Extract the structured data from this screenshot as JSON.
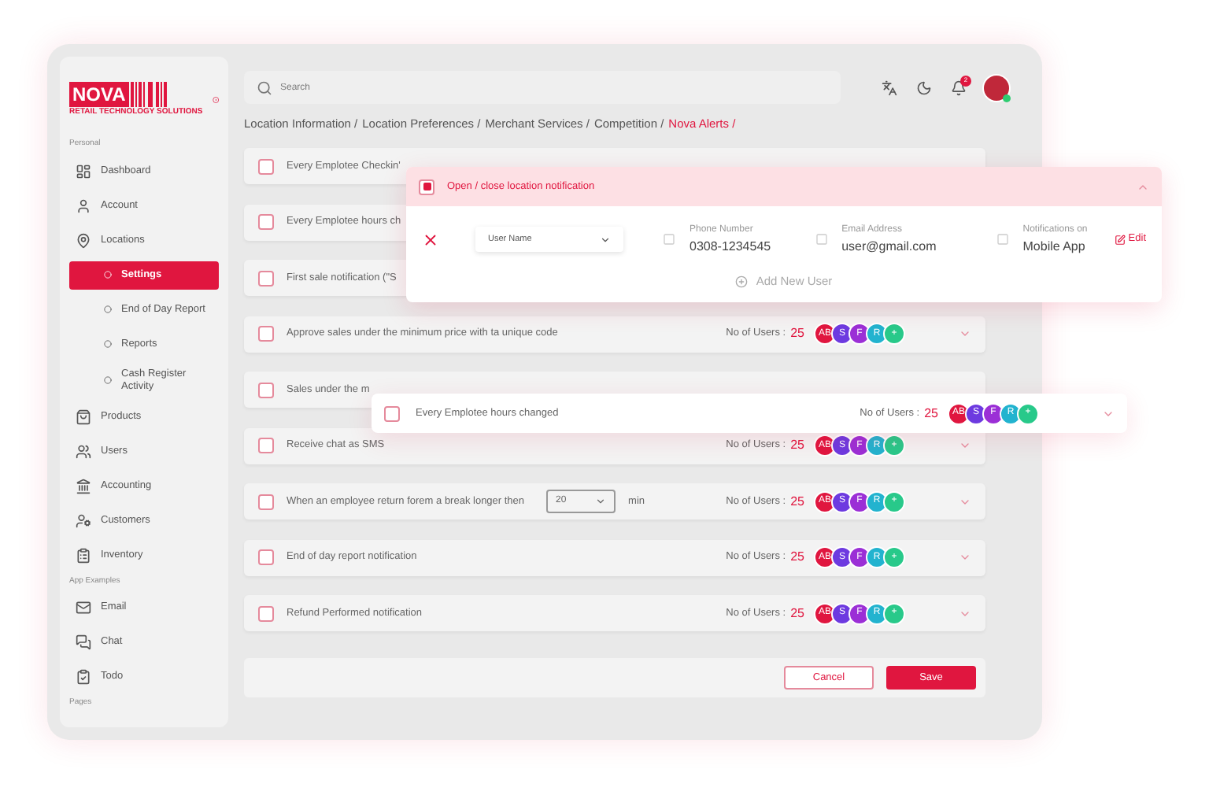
{
  "sidebar": {
    "logo": "NOVA",
    "tagline": "RETAIL TECHNOLOGY SOLUTIONS",
    "sections": [
      {
        "title": "Personal",
        "items": [
          {
            "label": "Dashboard",
            "selected": false
          },
          {
            "label": "Account",
            "selected": false
          },
          {
            "label": "Locations",
            "selected": false,
            "children": [
              {
                "label": "Settings",
                "selected": true
              },
              {
                "label": "End of Day Report",
                "selected": false
              },
              {
                "label": "Reports",
                "selected": false
              },
              {
                "label": "Cash Register Activity",
                "selected": false
              }
            ]
          },
          {
            "label": "Products",
            "selected": false
          },
          {
            "label": "Users",
            "selected": false
          },
          {
            "label": "Accounting",
            "selected": false
          },
          {
            "label": "Customers",
            "selected": false
          },
          {
            "label": "Inventory",
            "selected": false
          }
        ]
      },
      {
        "title": "App Examples",
        "items": [
          {
            "label": "Email",
            "selected": false
          },
          {
            "label": "Chat",
            "selected": false
          },
          {
            "label": "Todo",
            "selected": false
          }
        ]
      },
      {
        "title": "Pages"
      }
    ]
  },
  "topbar": {
    "search": {
      "placeholder": "Search"
    },
    "notification_count": "2"
  },
  "breadcrumb": [
    {
      "label": "Location Information /",
      "selected": false
    },
    {
      "label": "Location Preferences /",
      "selected": false
    },
    {
      "label": "Merchant Services /",
      "selected": false
    },
    {
      "label": "Competition /",
      "selected": false
    },
    {
      "label": "Nova Alerts /",
      "selected": true
    }
  ],
  "alerts": [
    {
      "kind": "covered",
      "label": "Every Emplotee Checkin'",
      "checked": false
    },
    {
      "kind": "covered",
      "label": "Every Emplotee hours ch",
      "checked": false
    },
    {
      "kind": "covered",
      "label": "First sale notification (\"S",
      "checked": false
    },
    {
      "kind": "plain",
      "label": "Approve sales under the minimum price with ta unique code",
      "checked": false,
      "users_label": "No of Users :",
      "users_count": "25",
      "avatars": [
        {
          "initials": "AB",
          "color": "#e0163f"
        },
        {
          "initials": "S",
          "color": "#6d3ae0"
        },
        {
          "initials": "F",
          "color": "#9b2fd6"
        },
        {
          "initials": "R",
          "color": "#22b3cf"
        },
        {
          "initials": "+",
          "color": "#28c98a"
        }
      ]
    },
    {
      "kind": "covered",
      "label": "Sales under the m",
      "checked": false
    },
    {
      "kind": "plain",
      "label": "Receive chat as SMS",
      "checked": false,
      "users_label": "No of Users :",
      "users_count": "25",
      "avatars": [
        {
          "initials": "AB",
          "color": "#e0163f"
        },
        {
          "initials": "S",
          "color": "#6d3ae0"
        },
        {
          "initials": "F",
          "color": "#9b2fd6"
        },
        {
          "initials": "R",
          "color": "#22b3cf"
        },
        {
          "initials": "+",
          "color": "#28c98a"
        }
      ]
    },
    {
      "kind": "select",
      "label": "When an employee return forem a break longer then",
      "checked": false,
      "select_value": "20",
      "unit": "min",
      "users_label": "No of Users :",
      "users_count": "25",
      "avatars": [
        {
          "initials": "AB",
          "color": "#e0163f"
        },
        {
          "initials": "S",
          "color": "#6d3ae0"
        },
        {
          "initials": "F",
          "color": "#9b2fd6"
        },
        {
          "initials": "R",
          "color": "#22b3cf"
        },
        {
          "initials": "+",
          "color": "#28c98a"
        }
      ]
    },
    {
      "kind": "plain",
      "label": "End of day report notification",
      "checked": false,
      "users_label": "No of Users :",
      "users_count": "25",
      "avatars": [
        {
          "initials": "AB",
          "color": "#e0163f"
        },
        {
          "initials": "S",
          "color": "#6d3ae0"
        },
        {
          "initials": "F",
          "color": "#9b2fd6"
        },
        {
          "initials": "R",
          "color": "#22b3cf"
        },
        {
          "initials": "+",
          "color": "#28c98a"
        }
      ]
    },
    {
      "kind": "plain",
      "label": "Refund Performed notification",
      "checked": false,
      "users_label": "No of Users :",
      "users_count": "25",
      "avatars": [
        {
          "initials": "AB",
          "color": "#e0163f"
        },
        {
          "initials": "S",
          "color": "#6d3ae0"
        },
        {
          "initials": "F",
          "color": "#9b2fd6"
        },
        {
          "initials": "R",
          "color": "#22b3cf"
        },
        {
          "initials": "+",
          "color": "#28c98a"
        }
      ]
    }
  ],
  "popup": {
    "title": "Open / close location notification",
    "checked": true,
    "expanded": true,
    "user_select": "User Name",
    "fields": [
      {
        "label": "Phone Number",
        "value": "0308-1234545"
      },
      {
        "label": "Email Address",
        "value": "user@gmail.com"
      },
      {
        "label": "Notifications on",
        "value": "Mobile App"
      }
    ],
    "edit": "Edit",
    "add_user": "Add New User"
  },
  "floating_row": {
    "label": "Every Emplotee hours changed",
    "checked": false,
    "users_label": "No of Users :",
    "users_count": "25",
    "avatars": [
      {
        "initials": "AB",
        "color": "#e0163f"
      },
      {
        "initials": "S",
        "color": "#6d3ae0"
      },
      {
        "initials": "F",
        "color": "#9b2fd6"
      },
      {
        "initials": "R",
        "color": "#22b3cf"
      },
      {
        "initials": "+",
        "color": "#28c98a"
      }
    ]
  },
  "actions": {
    "cancel": "Cancel",
    "save": "Save"
  }
}
